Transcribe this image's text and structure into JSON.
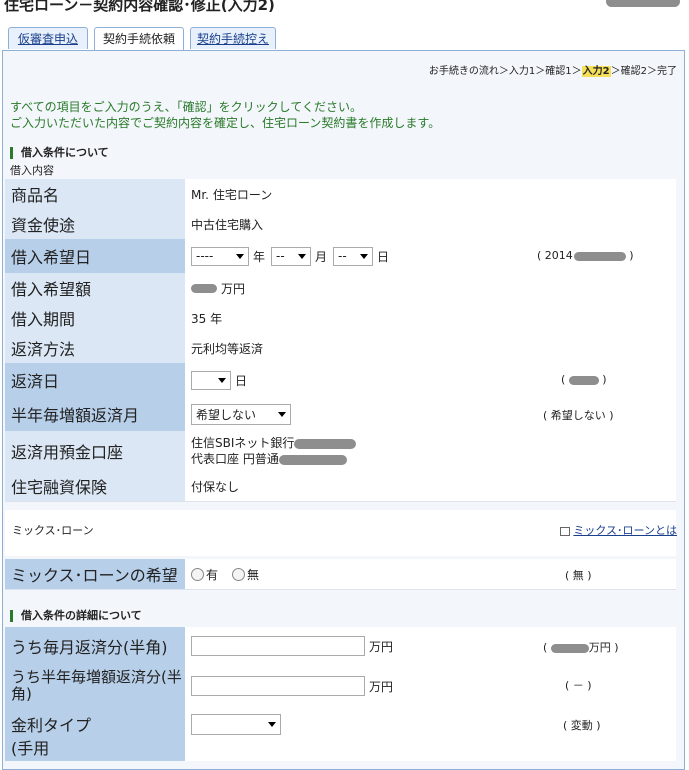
{
  "title": "住宅ローン－契約内容確認･修正(入力2)",
  "tabs": [
    {
      "label": "仮審査申込"
    },
    {
      "label": "契約手続依頼"
    },
    {
      "label": "契約手続控え"
    }
  ],
  "flow": {
    "prefix": "お手続きの流れ＞入力1＞確認1＞",
    "current": "入力2",
    "suffix": "＞確認2＞完了"
  },
  "intro": {
    "line1": "すべての項目をご入力のうえ、「確認」をクリックしてください。",
    "line2": "ご入力いただいた内容でご契約内容を確定し、住宅ローン契約書を作成します。"
  },
  "section1": {
    "heading": "借入条件について",
    "sub": "借入内容"
  },
  "rows": {
    "product": {
      "label": "商品名",
      "value": "Mr. 住宅ローン"
    },
    "purpose": {
      "label": "資金使途",
      "value": "中古住宅購入"
    },
    "date": {
      "label": "借入希望日",
      "year_sel": "----",
      "year_unit": "年",
      "month_sel": "--",
      "month_unit": "月",
      "day_sel": "--",
      "day_unit": "日",
      "note": "( 2014"
    },
    "amount": {
      "label": "借入希望額",
      "unit": "万円"
    },
    "period": {
      "label": "借入期間",
      "value": "35 年"
    },
    "method": {
      "label": "返済方法",
      "value": "元利均等返済"
    },
    "payday": {
      "label": "返済日",
      "unit": "日",
      "note_open": "(",
      "note_close": ")"
    },
    "bonus": {
      "label": "半年毎増額返済月",
      "selected": "希望しない",
      "note": "( 希望しない )"
    },
    "account": {
      "label": "返済用預金口座",
      "line1": "住信SBIネット銀行",
      "line2": "代表口座 円普通"
    },
    "insurance": {
      "label": "住宅融資保険",
      "value": "付保なし"
    }
  },
  "mix": {
    "label": "ミックス･ローン",
    "link": "ミックス･ローンとは",
    "row_label": "ミックス･ローンの希望",
    "opt_yes": "有",
    "opt_no": "無",
    "note": "( 無 )"
  },
  "section2": {
    "heading": "借入条件の詳細について"
  },
  "detail": {
    "monthly": {
      "label": "うち毎月返済分(半角)",
      "unit": "万円",
      "note_open": "(",
      "note_close": "万円 )"
    },
    "semi": {
      "label": "うち半年毎増額返済分(半角)",
      "unit": "万円",
      "note": "( － )"
    },
    "rate": {
      "label": "金利タイプ",
      "note": "( 変動 )"
    },
    "next_label": "(手用"
  },
  "icons": {
    "link": "link-icon",
    "dropdown": "chevron-down-icon",
    "radio": "radio-icon"
  },
  "colors": {
    "label_bg": "#dbe7f5",
    "label_req_bg": "#b7cfe9",
    "intro_text": "#2a7a2a",
    "flow_highlight": "#f6e05a",
    "link": "#1a3f8c"
  }
}
